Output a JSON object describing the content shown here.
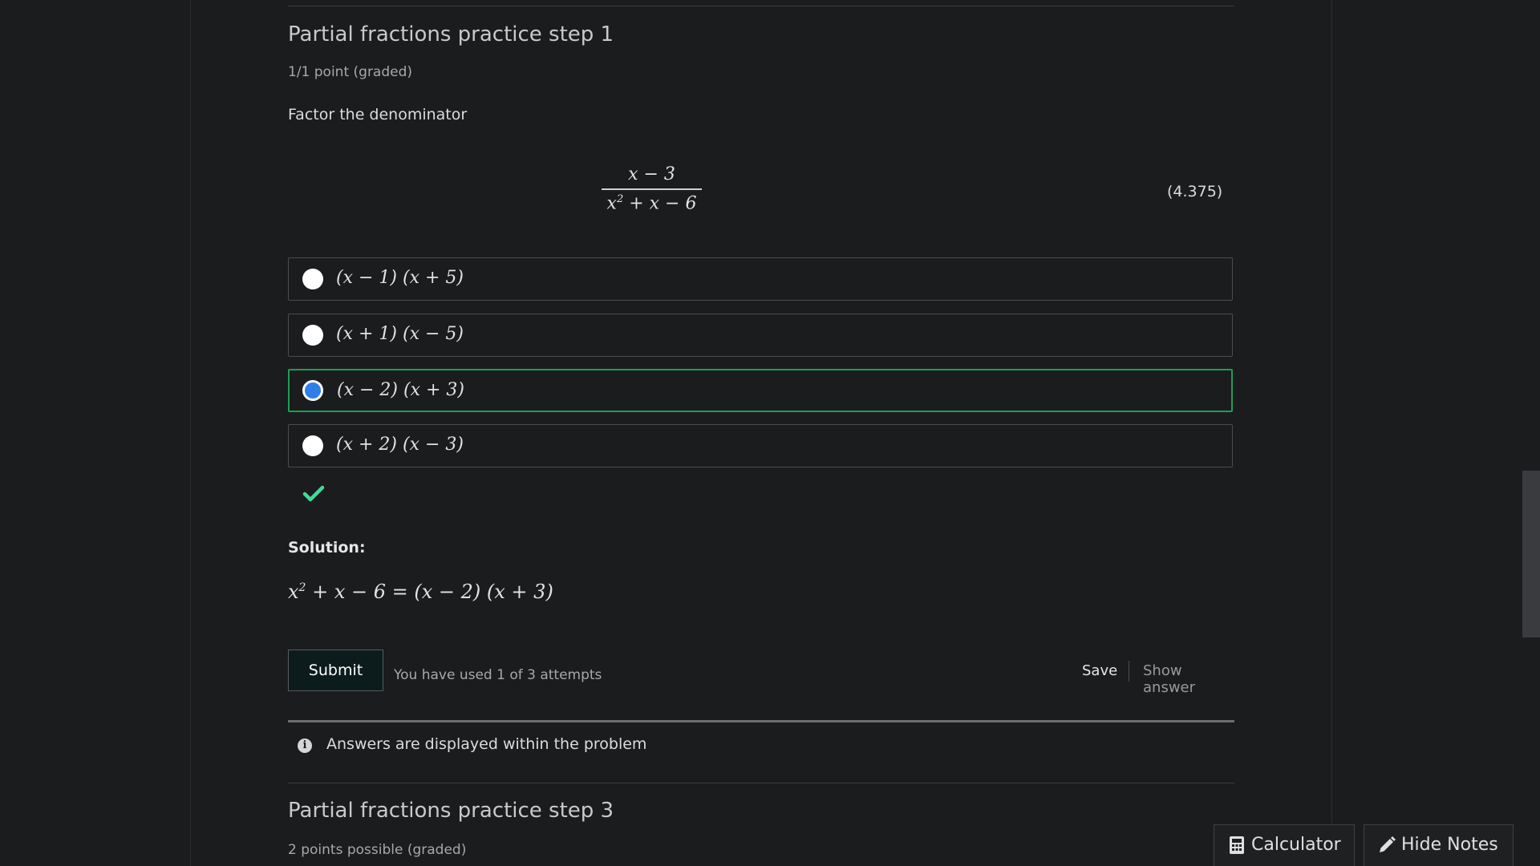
{
  "problem1": {
    "title": "Partial fractions practice step 1",
    "meta": "1/1 point (graded)",
    "prompt": "Factor the denominator",
    "fraction": {
      "numerator": "x − 3",
      "denominator_base": "x",
      "denominator_exp": "2",
      "denominator_rest": " + x − 6"
    },
    "equation_number": "(4.375)",
    "options": [
      {
        "text": "(x − 1) (x + 5)",
        "selected": false
      },
      {
        "text": "(x + 1) (x − 5)",
        "selected": false
      },
      {
        "text": "(x − 2) (x + 3)",
        "selected": true
      },
      {
        "text": "(x + 2) (x − 3)",
        "selected": false
      }
    ],
    "solution_label": "Solution:",
    "solution": {
      "base": "x",
      "exp": "2",
      "rest": " + x − 6 = (x − 2) (x + 3)"
    },
    "submit_label": "Submit",
    "attempts_text": "You have used 1 of 3 attempts",
    "save_label": "Save",
    "show_answer_label": "Show answer",
    "notice_text": "Answers are displayed within the problem"
  },
  "problem2": {
    "title": "Partial fractions practice step 3",
    "meta": "2 points possible (graded)"
  },
  "floating": {
    "calculator_label": "Calculator",
    "hide_notes_label": "Hide Notes"
  },
  "colors": {
    "background": "#1b1c1e",
    "correct_green": "#1f9d55",
    "check_green": "#3ddc97",
    "radio_blue": "#2f7fe8"
  },
  "icons": [
    "check-icon",
    "info-icon",
    "calculator-icon",
    "pencil-icon"
  ]
}
